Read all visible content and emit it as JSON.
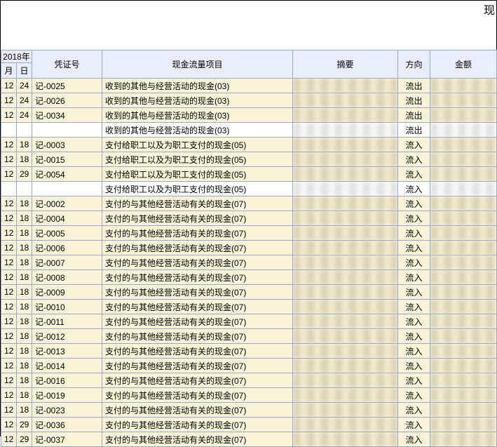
{
  "top_title": "现",
  "header": {
    "year": "2018年",
    "month": "月",
    "day": "日",
    "voucher_no": "凭证号",
    "cashflow_item": "现金流量项目",
    "summary": "摘要",
    "direction": "方向",
    "amount": "金额"
  },
  "rows": [
    {
      "month": "12",
      "day": "24",
      "voucher": "记-0025",
      "item": "收到的其他与经营活动的现金(03)",
      "summary": "",
      "dir": "流出",
      "amount": "",
      "subtotal": false
    },
    {
      "month": "12",
      "day": "24",
      "voucher": "记-0026",
      "item": "收到的其他与经营活动的现金(03)",
      "summary": "",
      "dir": "流出",
      "amount": "",
      "subtotal": false
    },
    {
      "month": "12",
      "day": "24",
      "voucher": "记-0034",
      "item": "收到的其他与经营活动的现金(03)",
      "summary": "",
      "dir": "流出",
      "amount": "",
      "subtotal": false
    },
    {
      "month": "",
      "day": "",
      "voucher": "",
      "item": "收到的其他与经营活动的现金(03)",
      "summary": "",
      "dir": "流出",
      "amount": "",
      "subtotal": true
    },
    {
      "month": "12",
      "day": "18",
      "voucher": "记-0003",
      "item": "支付给职工以及为职工支付的现金(05)",
      "summary": "",
      "dir": "流入",
      "amount": "",
      "subtotal": false
    },
    {
      "month": "12",
      "day": "18",
      "voucher": "记-0015",
      "item": "支付给职工以及为职工支付的现金(05)",
      "summary": "",
      "dir": "流入",
      "amount": "",
      "subtotal": false
    },
    {
      "month": "12",
      "day": "29",
      "voucher": "记-0054",
      "item": "支付给职工以及为职工支付的现金(05)",
      "summary": "",
      "dir": "流入",
      "amount": "",
      "subtotal": false
    },
    {
      "month": "",
      "day": "",
      "voucher": "",
      "item": "支付给职工以及为职工支付的现金(05)",
      "summary": "",
      "dir": "流入",
      "amount": "",
      "subtotal": true
    },
    {
      "month": "12",
      "day": "18",
      "voucher": "记-0002",
      "item": "支付的与其他经营活动有关的现金(07)",
      "summary": "",
      "dir": "流入",
      "amount": "",
      "subtotal": false
    },
    {
      "month": "12",
      "day": "18",
      "voucher": "记-0004",
      "item": "支付的与其他经营活动有关的现金(07)",
      "summary": "",
      "dir": "流入",
      "amount": "",
      "subtotal": false
    },
    {
      "month": "12",
      "day": "18",
      "voucher": "记-0005",
      "item": "支付的与其他经营活动有关的现金(07)",
      "summary": "",
      "dir": "流入",
      "amount": "",
      "subtotal": false
    },
    {
      "month": "12",
      "day": "18",
      "voucher": "记-0006",
      "item": "支付的与其他经营活动有关的现金(07)",
      "summary": "",
      "dir": "流入",
      "amount": "",
      "subtotal": false
    },
    {
      "month": "12",
      "day": "18",
      "voucher": "记-0007",
      "item": "支付的与其他经营活动有关的现金(07)",
      "summary": "",
      "dir": "流入",
      "amount": "",
      "subtotal": false
    },
    {
      "month": "12",
      "day": "18",
      "voucher": "记-0008",
      "item": "支付的与其他经营活动有关的现金(07)",
      "summary": "",
      "dir": "流入",
      "amount": "",
      "subtotal": false
    },
    {
      "month": "12",
      "day": "18",
      "voucher": "记-0009",
      "item": "支付的与其他经营活动有关的现金(07)",
      "summary": "",
      "dir": "流入",
      "amount": "",
      "subtotal": false
    },
    {
      "month": "12",
      "day": "18",
      "voucher": "记-0010",
      "item": "支付的与其他经营活动有关的现金(07)",
      "summary": "",
      "dir": "流入",
      "amount": "",
      "subtotal": false
    },
    {
      "month": "12",
      "day": "18",
      "voucher": "记-0011",
      "item": "支付的与其他经营活动有关的现金(07)",
      "summary": "",
      "dir": "流入",
      "amount": "",
      "subtotal": false
    },
    {
      "month": "12",
      "day": "18",
      "voucher": "记-0012",
      "item": "支付的与其他经营活动有关的现金(07)",
      "summary": "",
      "dir": "流入",
      "amount": "",
      "subtotal": false
    },
    {
      "month": "12",
      "day": "18",
      "voucher": "记-0013",
      "item": "支付的与其他经营活动有关的现金(07)",
      "summary": "",
      "dir": "流入",
      "amount": "",
      "subtotal": false
    },
    {
      "month": "12",
      "day": "18",
      "voucher": "记-0014",
      "item": "支付的与其他经营活动有关的现金(07)",
      "summary": "",
      "dir": "流入",
      "amount": "",
      "subtotal": false
    },
    {
      "month": "12",
      "day": "18",
      "voucher": "记-0016",
      "item": "支付的与其他经营活动有关的现金(07)",
      "summary": "",
      "dir": "流入",
      "amount": "",
      "subtotal": false
    },
    {
      "month": "12",
      "day": "18",
      "voucher": "记-0019",
      "item": "支付的与其他经营活动有关的现金(07)",
      "summary": "",
      "dir": "流入",
      "amount": "",
      "subtotal": false
    },
    {
      "month": "12",
      "day": "18",
      "voucher": "记-0023",
      "item": "支付的与其他经营活动有关的现金(07)",
      "summary": "",
      "dir": "流入",
      "amount": "",
      "subtotal": false
    },
    {
      "month": "12",
      "day": "29",
      "voucher": "记-0036",
      "item": "支付的与其他经营活动有关的现金(07)",
      "summary": "",
      "dir": "流入",
      "amount": "",
      "subtotal": false
    },
    {
      "month": "12",
      "day": "29",
      "voucher": "记-0037",
      "item": "支付的与其他经营活动有关的现金(07)",
      "summary": "",
      "dir": "流入",
      "amount": "",
      "subtotal": false
    }
  ]
}
